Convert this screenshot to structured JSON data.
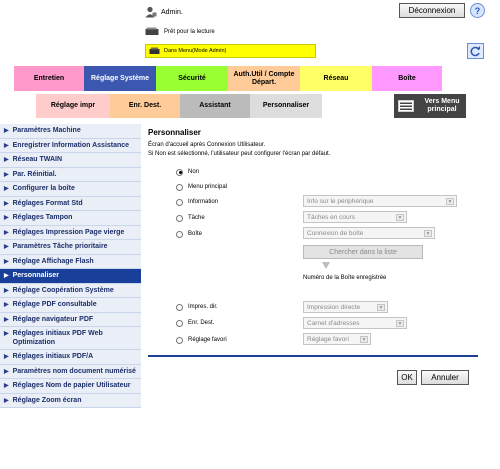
{
  "header": {
    "user": "Admin.",
    "logout_label": "Déconnexion",
    "help_label": "?",
    "status": "Prêt pour la lecture",
    "mode": "Dans Menu(Mode Admin)"
  },
  "tabs_row1": [
    {
      "label": "Entretien",
      "color": "#ff99cc"
    },
    {
      "label": "Réglage Système",
      "color": "#3b57b0",
      "active": true
    },
    {
      "label": "Sécurité",
      "color": "#99ff33"
    },
    {
      "label": "Auth.Util / Compte Départ.",
      "color": "#ffcc99"
    },
    {
      "label": "Réseau",
      "color": "#ffff66"
    },
    {
      "label": "Boîte",
      "color": "#ff99ff"
    }
  ],
  "tabs_row2": [
    {
      "label": "Réglage impr",
      "color": "#ffcccc"
    },
    {
      "label": "Enr. Dest.",
      "color": "#ffcc99"
    },
    {
      "label": "Assistant",
      "color": "#bbbbbb"
    },
    {
      "label": "Personnaliser",
      "color": "#dddddd"
    },
    {
      "label": "Vers Menu principal",
      "color": "#444444"
    }
  ],
  "sidebar": [
    "Paramètres Machine",
    "Enregistrer Information Assistance",
    "Réseau TWAIN",
    "Par. Réinitial.",
    "Configurer la boîte",
    "Réglages Format Std",
    "Réglages Tampon",
    "Réglages Impression Page vierge",
    "Paramètres Tâche prioritaire",
    "Réglage Affichage Flash",
    "Personnaliser",
    "Réglage Coopération Système",
    "Réglage PDF consultable",
    "Réglage navigateur PDF",
    "Réglages initiaux PDF Web Optimization",
    "Réglages initiaux PDF/A",
    "Paramètres nom document numérisé",
    "Réglages Nom de papier Utilisateur",
    "Réglage Zoom écran"
  ],
  "main": {
    "title": "Personnaliser",
    "desc1": "Écran d'accueil après Connexion Utilisateur.",
    "desc2": "Si Non est sélectionné, l'utilisateur peut configurer l'écran par défaut.",
    "options": {
      "non": "Non",
      "menu": "Menu principal",
      "info": "Information",
      "tache": "Tâche",
      "boite": "Boîte",
      "impres": "Impres. dir.",
      "enr": "Enr. Dest.",
      "favori": "Réglage favori"
    },
    "selects": {
      "info": "Info sur le périphérique",
      "tache": "Tâches en cours",
      "boite": "Connexion de boîte",
      "impres": "Impression directe",
      "enr": "Carnet d'adresses",
      "favori": "Réglage favori"
    },
    "search_label": "Chercher dans la liste",
    "box_number_label": "Numéro de la Boîte enregistrée",
    "ok_label": "OK",
    "cancel_label": "Annuler"
  }
}
